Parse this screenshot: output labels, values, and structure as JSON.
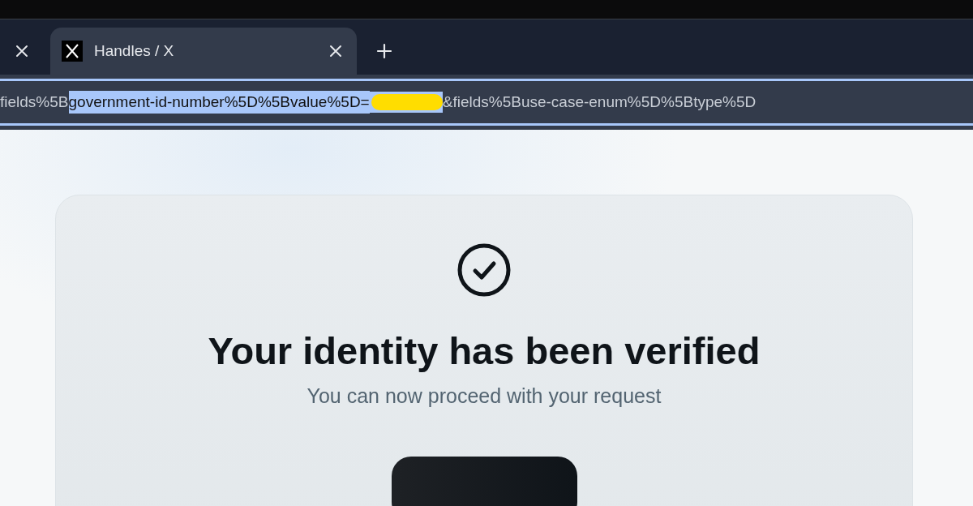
{
  "tabs": [
    {
      "kind": "partial",
      "selected": false
    },
    {
      "kind": "full",
      "title": "Handles / X",
      "selected": true
    }
  ],
  "address_bar": {
    "focused": true,
    "segments": [
      {
        "kind": "text",
        "text": "fields%5B",
        "selected": false
      },
      {
        "kind": "text",
        "text": "government-id-number%5D%5Bvalue%5D=",
        "selected": true
      },
      {
        "kind": "redacted",
        "selected": true
      },
      {
        "kind": "text",
        "text": "&fields%5Buse-case-enum%5D%5Btype%5D",
        "selected": false
      }
    ]
  },
  "card": {
    "heading": "Your identity has been verified",
    "subtitle": "You can now proceed with your request"
  }
}
